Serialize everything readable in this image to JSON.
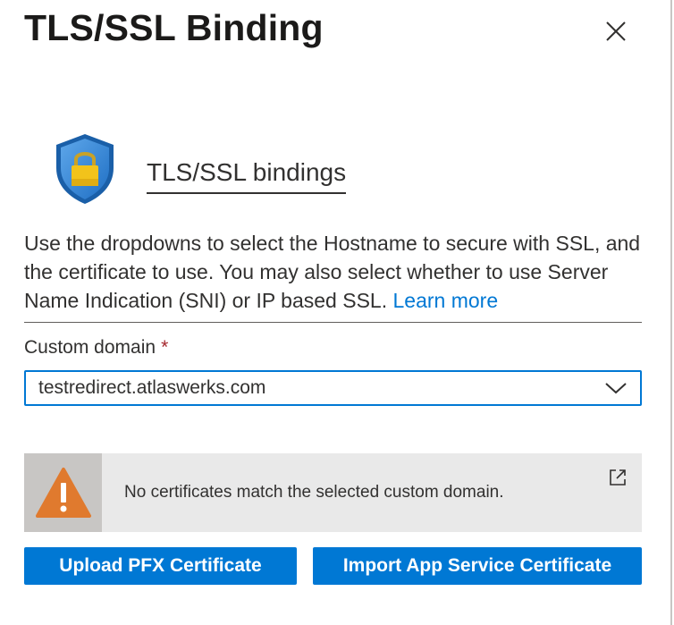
{
  "panel": {
    "title": "TLS/SSL Binding"
  },
  "section": {
    "heading": "TLS/SSL bindings",
    "description": "Use the dropdowns to select the Hostname to secure with SSL, and the certificate to use. You may also select whether to use Server Name Indication (SNI) or IP based SSL.",
    "learn_more": "Learn more"
  },
  "custom_domain": {
    "label": "Custom domain",
    "required_marker": "*",
    "value": "testredirect.atlaswerks.com"
  },
  "alert": {
    "message": "No certificates match the selected custom domain."
  },
  "buttons": {
    "upload": "Upload PFX Certificate",
    "import": "Import App Service Certificate"
  },
  "icons": {
    "close": "close-icon",
    "shield": "shield-lock-icon",
    "chevron": "chevron-down-icon",
    "warning": "warning-icon",
    "external": "external-link-icon"
  },
  "colors": {
    "accent": "#0078d4",
    "warning": "#e07a2e",
    "required": "#a4262c"
  }
}
